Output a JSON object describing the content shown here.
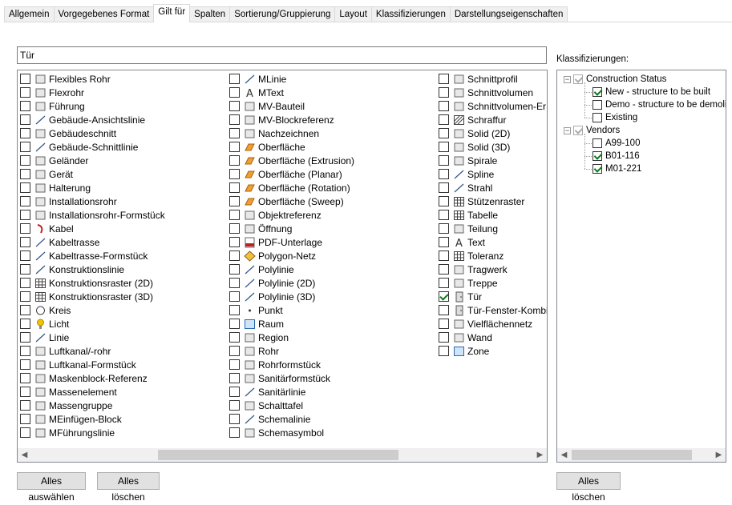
{
  "tabs": [
    "Allgemein",
    "Vorgegebenes Format",
    "Gilt für",
    "Spalten",
    "Sortierung/Gruppierung",
    "Layout",
    "Klassifizierungen",
    "Darstellungseigenschaften"
  ],
  "active_tab": 2,
  "filter": {
    "value": "Tür"
  },
  "object_list": {
    "columns": [
      [
        {
          "label": "Flexibles Rohr",
          "icon": "flexible-pipe-icon"
        },
        {
          "label": "Flexrohr",
          "icon": "flex-pipe-icon"
        },
        {
          "label": "Führung",
          "icon": "guide-icon"
        },
        {
          "label": "Gebäude-Ansichtslinie",
          "icon": "building-elevation-line-icon"
        },
        {
          "label": "Gebäudeschnitt",
          "icon": "building-section-icon"
        },
        {
          "label": "Gebäude-Schnittlinie",
          "icon": "building-section-line-icon"
        },
        {
          "label": "Geländer",
          "icon": "railing-icon"
        },
        {
          "label": "Gerät",
          "icon": "device-icon"
        },
        {
          "label": "Halterung",
          "icon": "hanger-icon"
        },
        {
          "label": "Installationsrohr",
          "icon": "conduit-icon"
        },
        {
          "label": "Installationsrohr-Formstück",
          "icon": "conduit-fitting-icon"
        },
        {
          "label": "Kabel",
          "icon": "cable-icon"
        },
        {
          "label": "Kabeltrasse",
          "icon": "cable-tray-icon"
        },
        {
          "label": "Kabeltrasse-Formstück",
          "icon": "cable-tray-fitting-icon"
        },
        {
          "label": "Konstruktionslinie",
          "icon": "construction-line-icon"
        },
        {
          "label": "Konstruktionsraster (2D)",
          "icon": "grid-2d-icon"
        },
        {
          "label": "Konstruktionsraster (3D)",
          "icon": "grid-3d-icon"
        },
        {
          "label": "Kreis",
          "icon": "circle-icon"
        },
        {
          "label": "Licht",
          "icon": "light-bulb-icon"
        },
        {
          "label": "Linie",
          "icon": "line-icon"
        },
        {
          "label": "Luftkanal/-rohr",
          "icon": "duct-icon"
        },
        {
          "label": "Luftkanal-Formstück",
          "icon": "duct-fitting-icon"
        },
        {
          "label": "Maskenblock-Referenz",
          "icon": "mask-block-icon"
        },
        {
          "label": "Massenelement",
          "icon": "mass-element-icon"
        },
        {
          "label": "Massengruppe",
          "icon": "mass-group-icon"
        },
        {
          "label": "MEinfügen-Block",
          "icon": "multi-insert-block-icon"
        },
        {
          "label": "MFührungslinie",
          "icon": "multileader-icon"
        }
      ],
      [
        {
          "label": "MLinie",
          "icon": "mline-icon"
        },
        {
          "label": "MText",
          "icon": "mtext-icon"
        },
        {
          "label": "MV-Bauteil",
          "icon": "mv-part-icon"
        },
        {
          "label": "MV-Blockreferenz",
          "icon": "mv-block-icon"
        },
        {
          "label": "Nachzeichnen",
          "icon": "trace-icon"
        },
        {
          "label": "Oberfläche",
          "icon": "surface-icon"
        },
        {
          "label": "Oberfläche (Extrusion)",
          "icon": "surface-extrusion-icon"
        },
        {
          "label": "Oberfläche (Planar)",
          "icon": "surface-planar-icon"
        },
        {
          "label": "Oberfläche (Rotation)",
          "icon": "surface-revolve-icon"
        },
        {
          "label": "Oberfläche (Sweep)",
          "icon": "surface-sweep-icon"
        },
        {
          "label": "Objektreferenz",
          "icon": "object-reference-icon"
        },
        {
          "label": "Öffnung",
          "icon": "opening-icon"
        },
        {
          "label": "PDF-Unterlage",
          "icon": "pdf-underlay-icon"
        },
        {
          "label": "Polygon-Netz",
          "icon": "polygon-mesh-icon"
        },
        {
          "label": "Polylinie",
          "icon": "polyline-icon"
        },
        {
          "label": "Polylinie (2D)",
          "icon": "polyline-2d-icon"
        },
        {
          "label": "Polylinie (3D)",
          "icon": "polyline-3d-icon"
        },
        {
          "label": "Punkt",
          "icon": "point-icon"
        },
        {
          "label": "Raum",
          "icon": "space-icon"
        },
        {
          "label": "Region",
          "icon": "region-icon"
        },
        {
          "label": "Rohr",
          "icon": "pipe-icon"
        },
        {
          "label": "Rohrformstück",
          "icon": "pipe-fitting-icon"
        },
        {
          "label": "Sanitärformstück",
          "icon": "plumbing-fitting-icon"
        },
        {
          "label": "Sanitärlinie",
          "icon": "plumbing-line-icon"
        },
        {
          "label": "Schalttafel",
          "icon": "panel-icon"
        },
        {
          "label": "Schemalinie",
          "icon": "schematic-line-icon"
        },
        {
          "label": "Schemasymbol",
          "icon": "schematic-symbol-icon"
        }
      ],
      [
        {
          "label": "Schnittprofil",
          "icon": "section-profile-icon"
        },
        {
          "label": "Schnittvolumen",
          "icon": "section-volume-icon"
        },
        {
          "label": "Schnittvolumen-Er",
          "icon": "section-volume-result-icon"
        },
        {
          "label": "Schraffur",
          "icon": "hatch-icon"
        },
        {
          "label": "Solid (2D)",
          "icon": "solid-2d-icon"
        },
        {
          "label": "Solid (3D)",
          "icon": "solid-3d-icon"
        },
        {
          "label": "Spirale",
          "icon": "helix-icon"
        },
        {
          "label": "Spline",
          "icon": "spline-icon"
        },
        {
          "label": "Strahl",
          "icon": "ray-icon"
        },
        {
          "label": "Stützenraster",
          "icon": "column-grid-icon"
        },
        {
          "label": "Tabelle",
          "icon": "table-icon"
        },
        {
          "label": "Teilung",
          "icon": "division-icon"
        },
        {
          "label": "Text",
          "icon": "text-icon"
        },
        {
          "label": "Toleranz",
          "icon": "tolerance-icon"
        },
        {
          "label": "Tragwerk",
          "icon": "structure-icon"
        },
        {
          "label": "Treppe",
          "icon": "stair-icon"
        },
        {
          "label": "Tür",
          "icon": "door-icon",
          "checked": true
        },
        {
          "label": "Tür-Fenster-Kombi",
          "icon": "door-window-assembly-icon"
        },
        {
          "label": "Vielflächennetz",
          "icon": "polyface-mesh-icon"
        },
        {
          "label": "Wand",
          "icon": "wall-icon"
        },
        {
          "label": "Zone",
          "icon": "zone-icon"
        }
      ]
    ]
  },
  "classification": {
    "label": "Klassifizierungen:",
    "tree": [
      {
        "label": "Construction Status",
        "children": [
          {
            "label": "New - structure to be built",
            "checked": true
          },
          {
            "label": "Demo - structure to be demolis",
            "checked": false
          },
          {
            "label": "Existing",
            "checked": false
          }
        ]
      },
      {
        "label": "Vendors",
        "children": [
          {
            "label": "A99-100",
            "checked": false
          },
          {
            "label": "B01-116",
            "checked": true
          },
          {
            "label": "M01-221",
            "checked": true
          }
        ]
      }
    ]
  },
  "buttons": {
    "select_all": "Alles auswählen",
    "clear_all": "Alles löschen",
    "clear_classifications": "Alles löschen"
  }
}
